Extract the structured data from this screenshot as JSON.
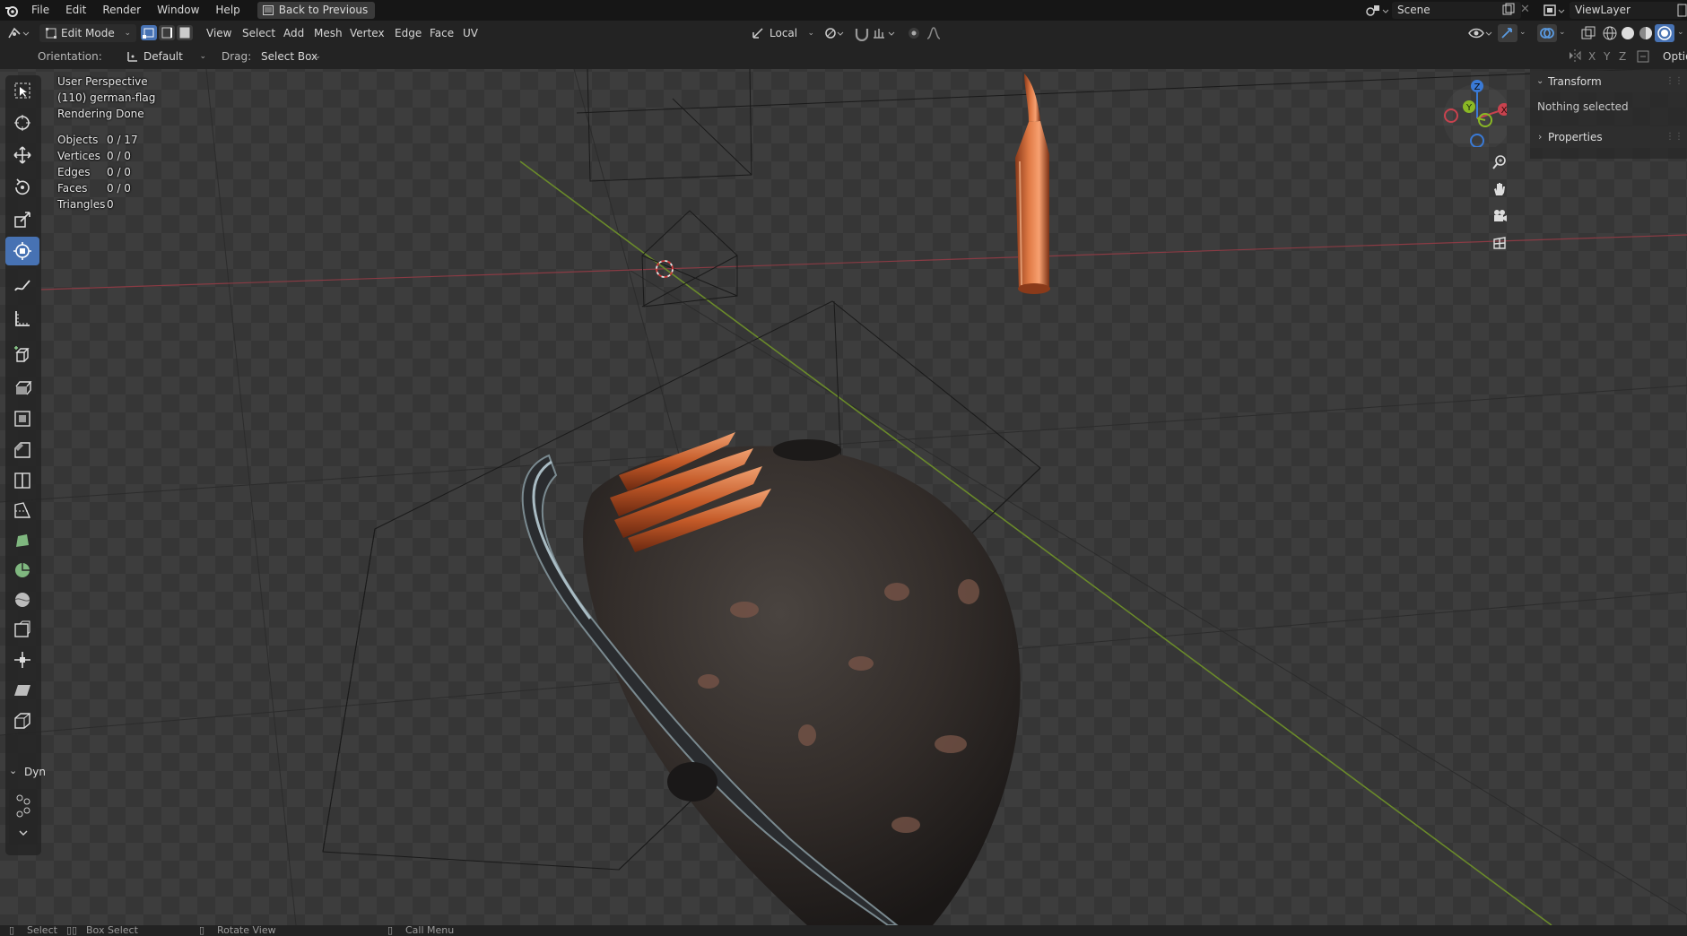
{
  "menu": {
    "items": [
      "File",
      "Edit",
      "Render",
      "Window",
      "Help"
    ],
    "back_button": "Back to Previous"
  },
  "scene": {
    "name": "Scene",
    "view_layer": "ViewLayer"
  },
  "header": {
    "mode": "Edit Mode",
    "menus": [
      "View",
      "Select",
      "Add",
      "Mesh",
      "Vertex",
      "Edge",
      "Face",
      "UV"
    ],
    "transform_orientation": "Local",
    "axis_labels": [
      "X",
      "Y",
      "Z"
    ],
    "options_label": "Optio"
  },
  "tool_options": {
    "orientation_label": "Orientation:",
    "orientation_value": "Default",
    "drag_label": "Drag:",
    "drag_value": "Select Box"
  },
  "viewport": {
    "perspective": "User Perspective",
    "object_info": "(110) german-flag",
    "render_status": "Rendering Done",
    "stats": [
      {
        "label": "Objects",
        "value": "0 / 17"
      },
      {
        "label": "Vertices",
        "value": "0 / 0"
      },
      {
        "label": "Edges",
        "value": "0 / 0"
      },
      {
        "label": "Faces",
        "value": "0 / 0"
      },
      {
        "label": "Triangles",
        "value": "0"
      }
    ]
  },
  "toolbar": {
    "dyn_label": "Dyn",
    "tools": [
      "select-box",
      "cursor",
      "move",
      "rotate",
      "scale",
      "transform",
      "annotate",
      "measure",
      "add-cube",
      "extrude-region",
      "inset-faces",
      "bevel",
      "loop-cut",
      "knife",
      "poly-build",
      "spin",
      "smooth",
      "edge-slide",
      "shrink-fatten",
      "shear",
      "rip-region"
    ]
  },
  "npanel": {
    "transform_title": "Transform",
    "nothing_selected": "Nothing selected",
    "properties_title": "Properties"
  },
  "statusbar": {
    "items": [
      "Select",
      "Box Select",
      "Rotate View",
      "Call Menu"
    ]
  },
  "colors": {
    "accent": "#4772b3",
    "x_axis": "#c8424e",
    "y_axis": "#8ab825",
    "z_axis": "#3a7ad6"
  }
}
